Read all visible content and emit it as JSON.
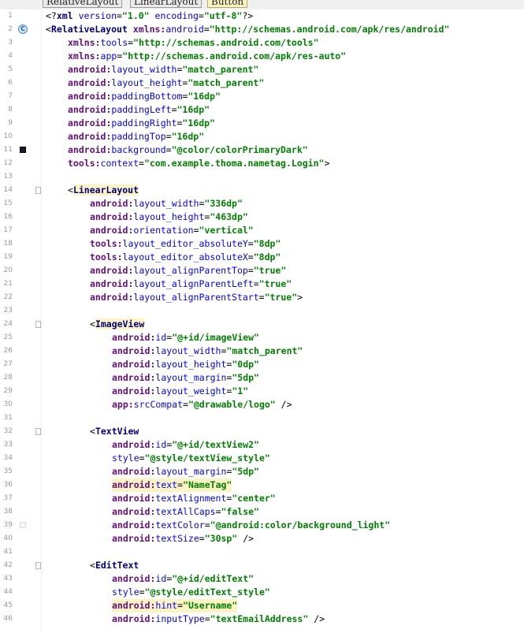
{
  "breadcrumbs": [
    "RelativeLayout",
    "LinearLayout",
    "Button"
  ],
  "gutter_icons": {
    "class_marker_letter": "C",
    "color_swatch_dark": "#1a1a2e",
    "color_swatch_light": "#f4f4f4"
  },
  "colors": {
    "tag": "#000080",
    "namespace": "#660e7a",
    "attribute": "#0000ff",
    "value": "#008000",
    "highlight": "#fbf3c4",
    "line_number": "#999999"
  },
  "lines": [
    {
      "n": "1",
      "indent": 0,
      "tokens": [
        [
          "p",
          "<?"
        ],
        [
          "tag",
          "xml "
        ],
        [
          "attr",
          "version"
        ],
        [
          "p",
          "="
        ],
        [
          "val",
          "\"1.0\""
        ],
        [
          "p",
          " "
        ],
        [
          "attr",
          "encoding"
        ],
        [
          "p",
          "="
        ],
        [
          "val",
          "\"utf-8\""
        ],
        [
          "p",
          "?>"
        ]
      ]
    },
    {
      "n": "2",
      "indent": 0,
      "marker": "class",
      "tokens": [
        [
          "p",
          "<"
        ],
        [
          "tag",
          "RelativeLayout "
        ],
        [
          "ans",
          "xmlns:"
        ],
        [
          "attr",
          "android"
        ],
        [
          "p",
          "="
        ],
        [
          "val",
          "\"http://schemas.android.com/apk/res/android\""
        ]
      ]
    },
    {
      "n": "3",
      "indent": 1,
      "tokens": [
        [
          "ans",
          "xmlns:"
        ],
        [
          "attr",
          "tools"
        ],
        [
          "p",
          "="
        ],
        [
          "val",
          "\"http://schemas.android.com/tools\""
        ]
      ]
    },
    {
      "n": "4",
      "indent": 1,
      "tokens": [
        [
          "ans",
          "xmlns:"
        ],
        [
          "attr",
          "app"
        ],
        [
          "p",
          "="
        ],
        [
          "val",
          "\"http://schemas.android.com/apk/res-auto\""
        ]
      ]
    },
    {
      "n": "5",
      "indent": 1,
      "tokens": [
        [
          "ans",
          "android:"
        ],
        [
          "attr",
          "layout_width"
        ],
        [
          "p",
          "="
        ],
        [
          "val",
          "\"match_parent\""
        ]
      ]
    },
    {
      "n": "6",
      "indent": 1,
      "tokens": [
        [
          "ans",
          "android:"
        ],
        [
          "attr",
          "layout_height"
        ],
        [
          "p",
          "="
        ],
        [
          "val",
          "\"match_parent\""
        ]
      ]
    },
    {
      "n": "7",
      "indent": 1,
      "tokens": [
        [
          "ans",
          "android:"
        ],
        [
          "attr",
          "paddingBottom"
        ],
        [
          "p",
          "="
        ],
        [
          "val",
          "\"16dp\""
        ]
      ]
    },
    {
      "n": "8",
      "indent": 1,
      "tokens": [
        [
          "ans",
          "android:"
        ],
        [
          "attr",
          "paddingLeft"
        ],
        [
          "p",
          "="
        ],
        [
          "val",
          "\"16dp\""
        ]
      ]
    },
    {
      "n": "9",
      "indent": 1,
      "tokens": [
        [
          "ans",
          "android:"
        ],
        [
          "attr",
          "paddingRight"
        ],
        [
          "p",
          "="
        ],
        [
          "val",
          "\"16dp\""
        ]
      ]
    },
    {
      "n": "10",
      "indent": 1,
      "tokens": [
        [
          "ans",
          "android:"
        ],
        [
          "attr",
          "paddingTop"
        ],
        [
          "p",
          "="
        ],
        [
          "val",
          "\"16dp\""
        ]
      ]
    },
    {
      "n": "11",
      "indent": 1,
      "marker": "swatch-dark",
      "tokens": [
        [
          "ans",
          "android:"
        ],
        [
          "attr",
          "background"
        ],
        [
          "p",
          "="
        ],
        [
          "val",
          "\"@color/colorPrimaryDark\""
        ]
      ]
    },
    {
      "n": "12",
      "indent": 1,
      "tokens": [
        [
          "ans",
          "tools:"
        ],
        [
          "attr",
          "context"
        ],
        [
          "p",
          "="
        ],
        [
          "val",
          "\"com.example.thoma.nametag.Login\""
        ],
        [
          "p",
          ">"
        ]
      ]
    },
    {
      "n": "13",
      "indent": 0,
      "tokens": []
    },
    {
      "n": "14",
      "indent": 1,
      "fold": true,
      "tokens": [
        [
          "p",
          "<"
        ],
        [
          "tag-hl",
          "LinearLayout"
        ]
      ]
    },
    {
      "n": "15",
      "indent": 2,
      "tokens": [
        [
          "ans",
          "android:"
        ],
        [
          "attr",
          "layout_width"
        ],
        [
          "p",
          "="
        ],
        [
          "val",
          "\"336dp\""
        ]
      ]
    },
    {
      "n": "16",
      "indent": 2,
      "tokens": [
        [
          "ans",
          "android:"
        ],
        [
          "attr",
          "layout_height"
        ],
        [
          "p",
          "="
        ],
        [
          "val",
          "\"463dp\""
        ]
      ]
    },
    {
      "n": "17",
      "indent": 2,
      "tokens": [
        [
          "ans",
          "android:"
        ],
        [
          "attr",
          "orientation"
        ],
        [
          "p",
          "="
        ],
        [
          "val",
          "\"vertical\""
        ]
      ]
    },
    {
      "n": "18",
      "indent": 2,
      "tokens": [
        [
          "ans",
          "tools:"
        ],
        [
          "attr",
          "layout_editor_absoluteY"
        ],
        [
          "p",
          "="
        ],
        [
          "val",
          "\"8dp\""
        ]
      ]
    },
    {
      "n": "19",
      "indent": 2,
      "tokens": [
        [
          "ans",
          "tools:"
        ],
        [
          "attr",
          "layout_editor_absoluteX"
        ],
        [
          "p",
          "="
        ],
        [
          "val",
          "\"8dp\""
        ]
      ]
    },
    {
      "n": "20",
      "indent": 2,
      "tokens": [
        [
          "ans",
          "android:"
        ],
        [
          "attr",
          "layout_alignParentTop"
        ],
        [
          "p",
          "="
        ],
        [
          "val",
          "\"true\""
        ]
      ]
    },
    {
      "n": "21",
      "indent": 2,
      "tokens": [
        [
          "ans",
          "android:"
        ],
        [
          "attr",
          "layout_alignParentLeft"
        ],
        [
          "p",
          "="
        ],
        [
          "val",
          "\"true\""
        ]
      ]
    },
    {
      "n": "22",
      "indent": 2,
      "tokens": [
        [
          "ans",
          "android:"
        ],
        [
          "attr",
          "layout_alignParentStart"
        ],
        [
          "p",
          "="
        ],
        [
          "val",
          "\"true\""
        ],
        [
          "p",
          ">"
        ]
      ]
    },
    {
      "n": "23",
      "indent": 0,
      "tokens": []
    },
    {
      "n": "24",
      "indent": 2,
      "fold": true,
      "tokens": [
        [
          "p",
          "<"
        ],
        [
          "tag-hl",
          "ImageView"
        ]
      ]
    },
    {
      "n": "25",
      "indent": 3,
      "tokens": [
        [
          "ans",
          "android:"
        ],
        [
          "attr",
          "id"
        ],
        [
          "p",
          "="
        ],
        [
          "val",
          "\"@+id/imageView\""
        ]
      ]
    },
    {
      "n": "26",
      "indent": 3,
      "tokens": [
        [
          "ans",
          "android:"
        ],
        [
          "attr",
          "layout_width"
        ],
        [
          "p",
          "="
        ],
        [
          "val",
          "\"match_parent\""
        ]
      ]
    },
    {
      "n": "27",
      "indent": 3,
      "tokens": [
        [
          "ans",
          "android:"
        ],
        [
          "attr",
          "layout_height"
        ],
        [
          "p",
          "="
        ],
        [
          "val",
          "\"0dp\""
        ]
      ]
    },
    {
      "n": "28",
      "indent": 3,
      "tokens": [
        [
          "ans",
          "android:"
        ],
        [
          "attr",
          "layout_margin"
        ],
        [
          "p",
          "="
        ],
        [
          "val",
          "\"5dp\""
        ]
      ]
    },
    {
      "n": "29",
      "indent": 3,
      "tokens": [
        [
          "ans",
          "android:"
        ],
        [
          "attr",
          "layout_weight"
        ],
        [
          "p",
          "="
        ],
        [
          "val",
          "\"1\""
        ]
      ]
    },
    {
      "n": "30",
      "indent": 3,
      "tokens": [
        [
          "ans",
          "app:"
        ],
        [
          "attr",
          "srcCompat"
        ],
        [
          "p",
          "="
        ],
        [
          "val",
          "\"@drawable/logo\""
        ],
        [
          "p",
          " />"
        ]
      ]
    },
    {
      "n": "31",
      "indent": 0,
      "tokens": []
    },
    {
      "n": "32",
      "indent": 2,
      "fold": true,
      "tokens": [
        [
          "p",
          "<"
        ],
        [
          "tag",
          "TextView"
        ]
      ]
    },
    {
      "n": "33",
      "indent": 3,
      "tokens": [
        [
          "ans",
          "android:"
        ],
        [
          "attr",
          "id"
        ],
        [
          "p",
          "="
        ],
        [
          "val",
          "\"@+id/textView2\""
        ]
      ]
    },
    {
      "n": "34",
      "indent": 3,
      "tokens": [
        [
          "attr",
          "style"
        ],
        [
          "p",
          "="
        ],
        [
          "val",
          "\"@style/textView_style\""
        ]
      ]
    },
    {
      "n": "35",
      "indent": 3,
      "tokens": [
        [
          "ans",
          "android:"
        ],
        [
          "attr",
          "layout_margin"
        ],
        [
          "p",
          "="
        ],
        [
          "val",
          "\"5dp\""
        ]
      ]
    },
    {
      "n": "36",
      "indent": 3,
      "hl": true,
      "tokens": [
        [
          "ans",
          "android:"
        ],
        [
          "attr",
          "text"
        ],
        [
          "p",
          "="
        ],
        [
          "val",
          "\"NameTag\""
        ]
      ]
    },
    {
      "n": "37",
      "indent": 3,
      "tokens": [
        [
          "ans",
          "android:"
        ],
        [
          "attr",
          "textAlignment"
        ],
        [
          "p",
          "="
        ],
        [
          "val",
          "\"center\""
        ]
      ]
    },
    {
      "n": "38",
      "indent": 3,
      "tokens": [
        [
          "ans",
          "android:"
        ],
        [
          "attr",
          "textAllCaps"
        ],
        [
          "p",
          "="
        ],
        [
          "val",
          "\"false\""
        ]
      ]
    },
    {
      "n": "39",
      "indent": 3,
      "marker": "swatch-light",
      "tokens": [
        [
          "ans",
          "android:"
        ],
        [
          "attr",
          "textColor"
        ],
        [
          "p",
          "="
        ],
        [
          "val",
          "\"@android:color/background_light\""
        ]
      ]
    },
    {
      "n": "40",
      "indent": 3,
      "tokens": [
        [
          "ans",
          "android:"
        ],
        [
          "attr",
          "textSize"
        ],
        [
          "p",
          "="
        ],
        [
          "val",
          "\"30sp\""
        ],
        [
          "p",
          " />"
        ]
      ]
    },
    {
      "n": "41",
      "indent": 0,
      "tokens": []
    },
    {
      "n": "42",
      "indent": 2,
      "fold": true,
      "tokens": [
        [
          "p",
          "<"
        ],
        [
          "tag",
          "EditText"
        ]
      ]
    },
    {
      "n": "43",
      "indent": 3,
      "tokens": [
        [
          "ans",
          "android:"
        ],
        [
          "attr",
          "id"
        ],
        [
          "p",
          "="
        ],
        [
          "val",
          "\"@+id/editText\""
        ]
      ]
    },
    {
      "n": "44",
      "indent": 3,
      "tokens": [
        [
          "attr",
          "style"
        ],
        [
          "p",
          "="
        ],
        [
          "val",
          "\"@style/editText_style\""
        ]
      ]
    },
    {
      "n": "45",
      "indent": 3,
      "hl": true,
      "tokens": [
        [
          "ans",
          "android:"
        ],
        [
          "attr",
          "hint"
        ],
        [
          "p",
          "="
        ],
        [
          "val",
          "\"Username\""
        ]
      ]
    },
    {
      "n": "46",
      "indent": 3,
      "tokens": [
        [
          "ans",
          "android:"
        ],
        [
          "attr",
          "inputType"
        ],
        [
          "p",
          "="
        ],
        [
          "val",
          "\"textEmailAddress\""
        ],
        [
          "p",
          " />"
        ]
      ]
    }
  ]
}
